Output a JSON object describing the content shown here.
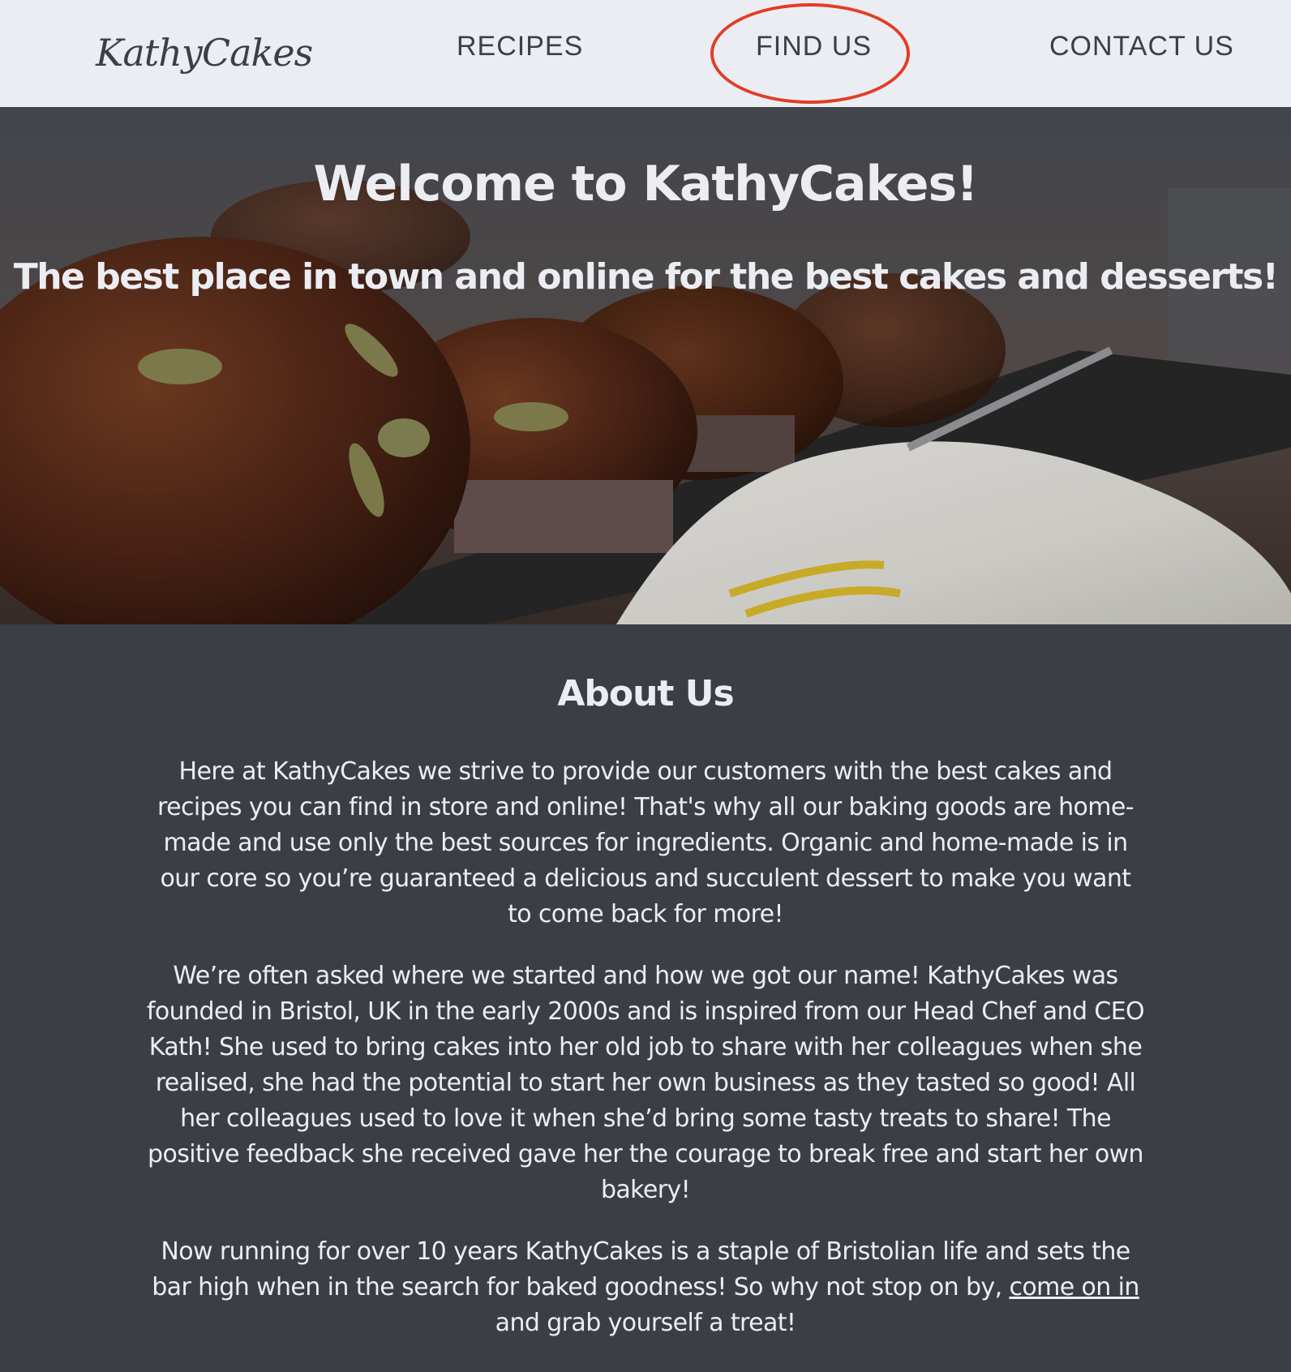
{
  "nav": {
    "logo": "KathyCakes",
    "links": [
      {
        "label": "RECIPES"
      },
      {
        "label": "FIND US",
        "highlighted": true
      },
      {
        "label": "CONTACT US"
      }
    ],
    "highlight_color": "#e13d27",
    "background": "#ecedf2"
  },
  "hero": {
    "title": "Welcome to KathyCakes!",
    "subtitle": "The best place in town and online for the best cakes and desserts!"
  },
  "about": {
    "title": "About Us",
    "paragraph1": "Here at KathyCakes we strive to provide our customers with the best cakes and recipes you can find in store and online! That's why all our baking goods are home-made and use only the best sources for ingredients. Organic and home-made is in our core so you’re guaranteed a delicious and succulent dessert to make you want to come back for more!",
    "paragraph2": "We’re often asked where we started and how we got our name! KathyCakes was founded in Bristol, UK in the early 2000s and is inspired from our Head Chef and CEO Kath! She used to bring cakes into her old job to share with her colleagues when she realised, she had the potential to start her own business as they tasted so good! All her colleagues used to love it when she’d bring some tasty treats to share! The positive feedback she received gave her the courage to break free and start her own bakery!",
    "paragraph3_before": "Now running for over 10 years KathyCakes is a staple of Bristolian life and sets the bar high when in the search for baked goodness! So why not stop on by, ",
    "paragraph3_link": "come on in",
    "paragraph3_after": " and grab yourself a treat!"
  },
  "colors": {
    "page_background": "#3b3f45",
    "text_light": "#ecedf3",
    "nav_text": "#3c3f45"
  }
}
